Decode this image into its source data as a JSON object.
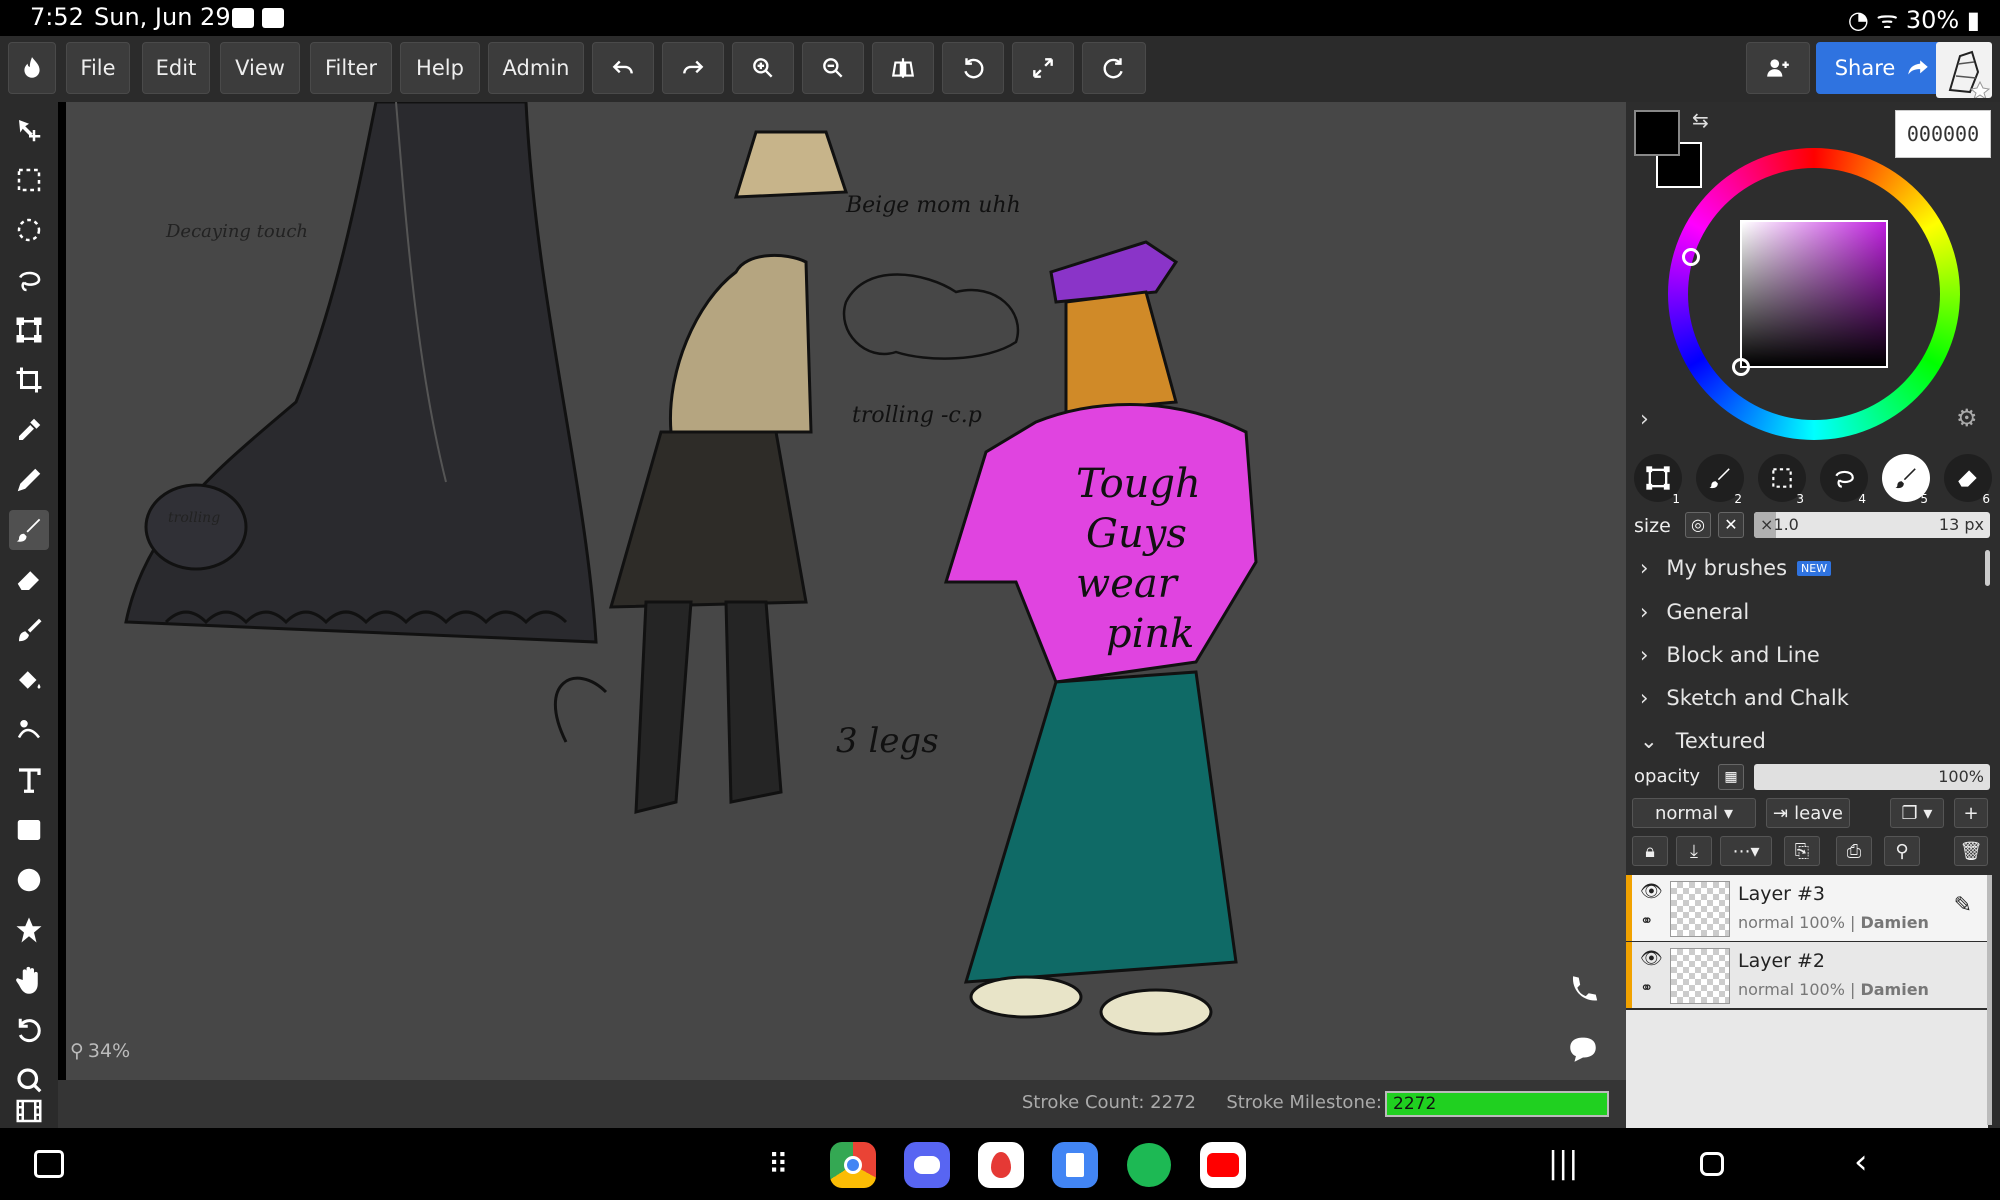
{
  "status": {
    "time": "7:52",
    "date": "Sun, Jun 29",
    "battery": "30%"
  },
  "menu": {
    "file": "File",
    "edit": "Edit",
    "view": "View",
    "filter": "Filter",
    "help": "Help",
    "admin": "Admin",
    "share": "Share"
  },
  "colors": {
    "hex": "000000",
    "primary": "#000000",
    "secondary": "#000000",
    "accent": "#2f73e0"
  },
  "brush": {
    "size_label": "size",
    "size_multiplier": "×1.0",
    "size_value": "13 px",
    "categories": [
      {
        "label": "My brushes",
        "badge": "NEW"
      },
      {
        "label": "General"
      },
      {
        "label": "Block and Line"
      },
      {
        "label": "Sketch and Chalk"
      },
      {
        "label": "Textured"
      }
    ],
    "tool_numbers": [
      "1",
      "2",
      "3",
      "4",
      "5",
      "6"
    ]
  },
  "opacity": {
    "label": "opacity",
    "value": "100%"
  },
  "blend": {
    "mode": "normal",
    "leave": "leave"
  },
  "layers": [
    {
      "name": "Layer #3",
      "mode": "normal",
      "opacity": "100%",
      "owner": "Damien"
    },
    {
      "name": "Layer #2",
      "mode": "normal",
      "opacity": "100%",
      "owner": "Damien"
    }
  ],
  "canvas": {
    "zoom": "34%",
    "stroke_count_label": "Stroke Count: 2272",
    "stroke_milestone_label": "Stroke Milestone:",
    "stroke_milestone_value": "2272"
  },
  "drawing_text": {
    "decaying_touch": "Decaying touch",
    "trolling_1": "trolling",
    "beige_mom": "Beige mom uhh",
    "trolling_2": "trolling -c.p",
    "three_legs": "3 legs",
    "shirt": "Tough Guys wear pink"
  }
}
